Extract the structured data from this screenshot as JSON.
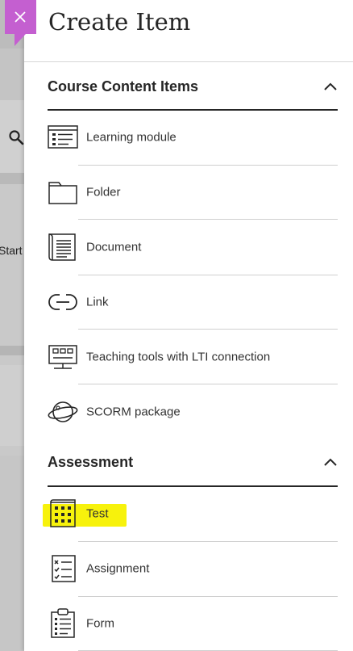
{
  "header": {
    "title": "Create Item",
    "close_icon": "close-icon",
    "accent": "#c45fd0"
  },
  "background": {
    "partial_text": "Start",
    "icon": "search-icon"
  },
  "sections": [
    {
      "label": "Course Content Items",
      "expanded": true,
      "items": [
        {
          "label": "Learning module",
          "icon": "learning-module-icon"
        },
        {
          "label": "Folder",
          "icon": "folder-icon"
        },
        {
          "label": "Document",
          "icon": "document-icon"
        },
        {
          "label": "Link",
          "icon": "link-icon"
        },
        {
          "label": "Teaching tools with LTI connection",
          "icon": "lti-tools-icon"
        },
        {
          "label": "SCORM package",
          "icon": "scorm-icon"
        }
      ]
    },
    {
      "label": "Assessment",
      "expanded": true,
      "items": [
        {
          "label": "Test",
          "icon": "test-icon",
          "highlighted": true,
          "highlight_color": "#f7f20c"
        },
        {
          "label": "Assignment",
          "icon": "assignment-icon"
        },
        {
          "label": "Form",
          "icon": "form-icon"
        }
      ]
    }
  ]
}
